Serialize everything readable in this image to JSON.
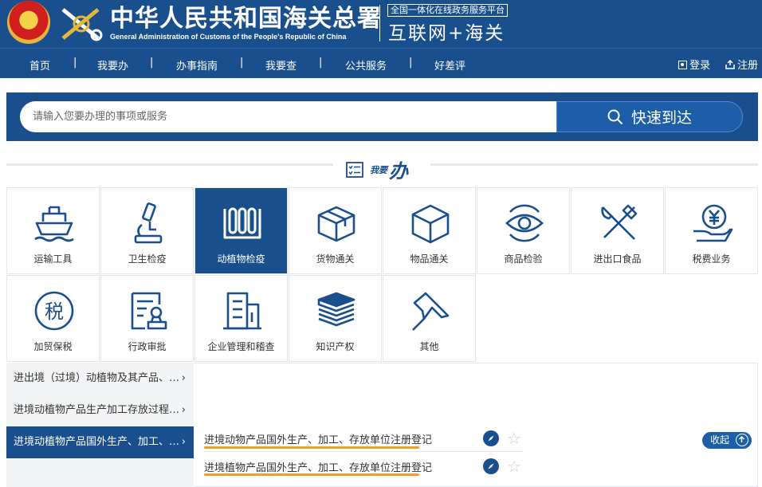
{
  "header": {
    "title_cn": "中华人民共和国海关总署",
    "title_en": "General Administration of Customs of the People's Republic of China",
    "platform_tag": "全国一体化在线政务服务平台",
    "platform_name": "互联网+海关"
  },
  "nav": {
    "items": [
      "首页",
      "我要办",
      "办事指南",
      "我要查",
      "公共服务",
      "好差评"
    ],
    "separator": "|",
    "login": "登录",
    "register": "注册"
  },
  "search": {
    "placeholder": "请输入您要办理的事项或服务",
    "button_label": "快速到达"
  },
  "section": {
    "title_small": "我要",
    "title_big": "办"
  },
  "categories": [
    {
      "label": "运输工具",
      "icon": "ship-icon"
    },
    {
      "label": "卫生检疫",
      "icon": "microscope-icon"
    },
    {
      "label": "动植物检疫",
      "icon": "cages-icon",
      "active": true
    },
    {
      "label": "货物通关",
      "icon": "open-box-icon"
    },
    {
      "label": "物品通关",
      "icon": "cube-icon"
    },
    {
      "label": "商品检验",
      "icon": "eye-icon"
    },
    {
      "label": "进出口食品",
      "icon": "fork-knife-icon"
    },
    {
      "label": "税费业务",
      "icon": "yuan-hand-icon"
    },
    {
      "label": "加贸保税",
      "icon": "tax-circle-icon"
    },
    {
      "label": "行政审批",
      "icon": "approval-stamp-icon"
    },
    {
      "label": "企业管理和稽查",
      "icon": "building-icon"
    },
    {
      "label": "知识产权",
      "icon": "books-icon"
    },
    {
      "label": "其他",
      "icon": "pushpin-icon"
    }
  ],
  "subcategories": [
    {
      "label": "进出境（过境）动植物及其产品、…"
    },
    {
      "label": "进境动植物产品生产加工存放过程…"
    },
    {
      "label": "进境动植物产品国外生产、加工、…",
      "active": true
    }
  ],
  "service_items": [
    {
      "label": "进境动物产品国外生产、加工、存放单位注册登记"
    },
    {
      "label": "进境植物产品国外生产、加工、存放单位注册登记"
    }
  ],
  "collapse_label": "收起",
  "colors": {
    "primary": "#1a4f8e",
    "accent_underline": "#e7a42a"
  }
}
